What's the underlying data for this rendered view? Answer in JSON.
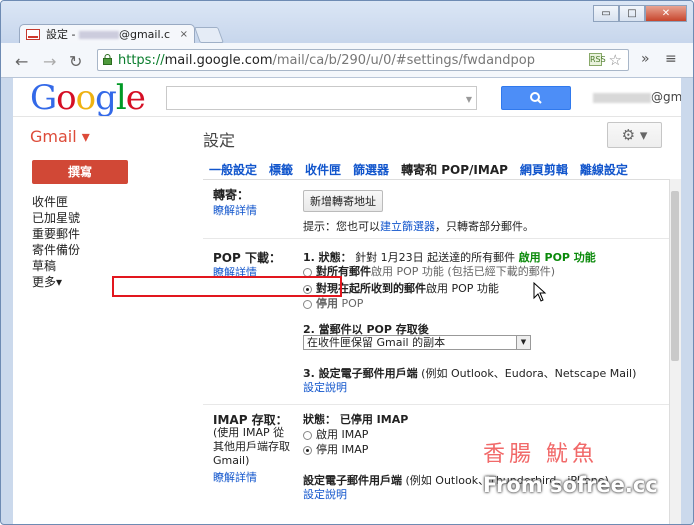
{
  "browser": {
    "tab_title": "設定 - ",
    "tab_title_suffix": "@gmail.c",
    "tab_close": "×",
    "window_buttons": {
      "minimize": "▭",
      "maximize": "□",
      "close": "✕"
    },
    "nav": {
      "back": "←",
      "forward": "→",
      "reload": "↻"
    },
    "url_scheme": "https://",
    "url_domain": "mail.google.com",
    "url_path": "/mail/ca/b/290/u/0/#settings/fwdandpop",
    "star": "☆",
    "ext_badge": "RSS",
    "overflow": "»",
    "wrench": "≡"
  },
  "header": {
    "logo_letters": [
      "G",
      "o",
      "o",
      "g",
      "l",
      "e"
    ],
    "logo_colors": [
      "#3369e8",
      "#d50f25",
      "#eeb211",
      "#3369e8",
      "#009925",
      "#d50f25"
    ],
    "search_placeholder": "",
    "search_dropdown": "▼",
    "search_icon": "search-icon",
    "account_suffix": "@gmail.com ▾"
  },
  "app": {
    "name": "Gmail ▾",
    "page_title": "設定",
    "gear": "⚙ ▾"
  },
  "sidebar": {
    "compose_label": "撰寫",
    "items": [
      "收件匣",
      "已加星號",
      "重要郵件",
      "寄件備份",
      "草稿",
      "更多▾"
    ]
  },
  "tabs": [
    {
      "label": "一般設定",
      "active": false
    },
    {
      "label": "標籤",
      "active": false
    },
    {
      "label": "收件匣",
      "active": false
    },
    {
      "label": "篩選器",
      "active": false
    },
    {
      "label": "轉寄和 POP/IMAP",
      "active": true
    },
    {
      "label": "網頁剪輯",
      "active": false
    },
    {
      "label": "離線設定",
      "active": false
    }
  ],
  "forwarding": {
    "title": "轉寄：",
    "learn_more": "瞭解詳情",
    "add_button": "新增轉寄地址",
    "tip_prefix": "提示：您也可以",
    "tip_link": "建立篩選器",
    "tip_suffix": "，只轉寄部分郵件。"
  },
  "pop": {
    "title": "POP 下載：",
    "learn_more": "瞭解詳情",
    "status_label": "1. 狀態：",
    "status_text": "針對 1月23日 起送達的所有郵件",
    "status_enabled": "啟用 POP 功能",
    "options": [
      {
        "bold": "對所有郵件",
        "text": "啟用 POP 功能 (包括已經下載的郵件)",
        "checked": false,
        "muted": true
      },
      {
        "bold": "對現在起所收到的郵件",
        "text": "啟用 POP 功能",
        "checked": true,
        "muted": false
      },
      {
        "bold": "停用",
        "text": " POP",
        "checked": false,
        "muted": true
      }
    ],
    "step2": "2. 當郵件以 POP 存取後",
    "step2_select": "在收件匣保留 Gmail 的副本",
    "step3_bold": "3. 設定電子郵件用戶端",
    "step3_text": " (例如 Outlook、Eudora、Netscape Mail)",
    "step3_link": "設定說明"
  },
  "imap": {
    "title": "IMAP 存取：",
    "desc": "(使用 IMAP 從其他用戶端存取 Gmail)",
    "learn_more": "瞭解詳情",
    "status_label": "狀態：",
    "status_value": "已停用 IMAP",
    "options": [
      {
        "text": "啟用 IMAP",
        "checked": false
      },
      {
        "text": "停用 IMAP",
        "checked": true
      }
    ],
    "client_bold": "設定電子郵件用戶端",
    "client_text": " (例如 Outlook、Thunderbird、iPhone)",
    "client_link": "設定說明"
  },
  "watermark": {
    "line1": "香腸  魷魚",
    "line2": "From sofree.cc"
  }
}
